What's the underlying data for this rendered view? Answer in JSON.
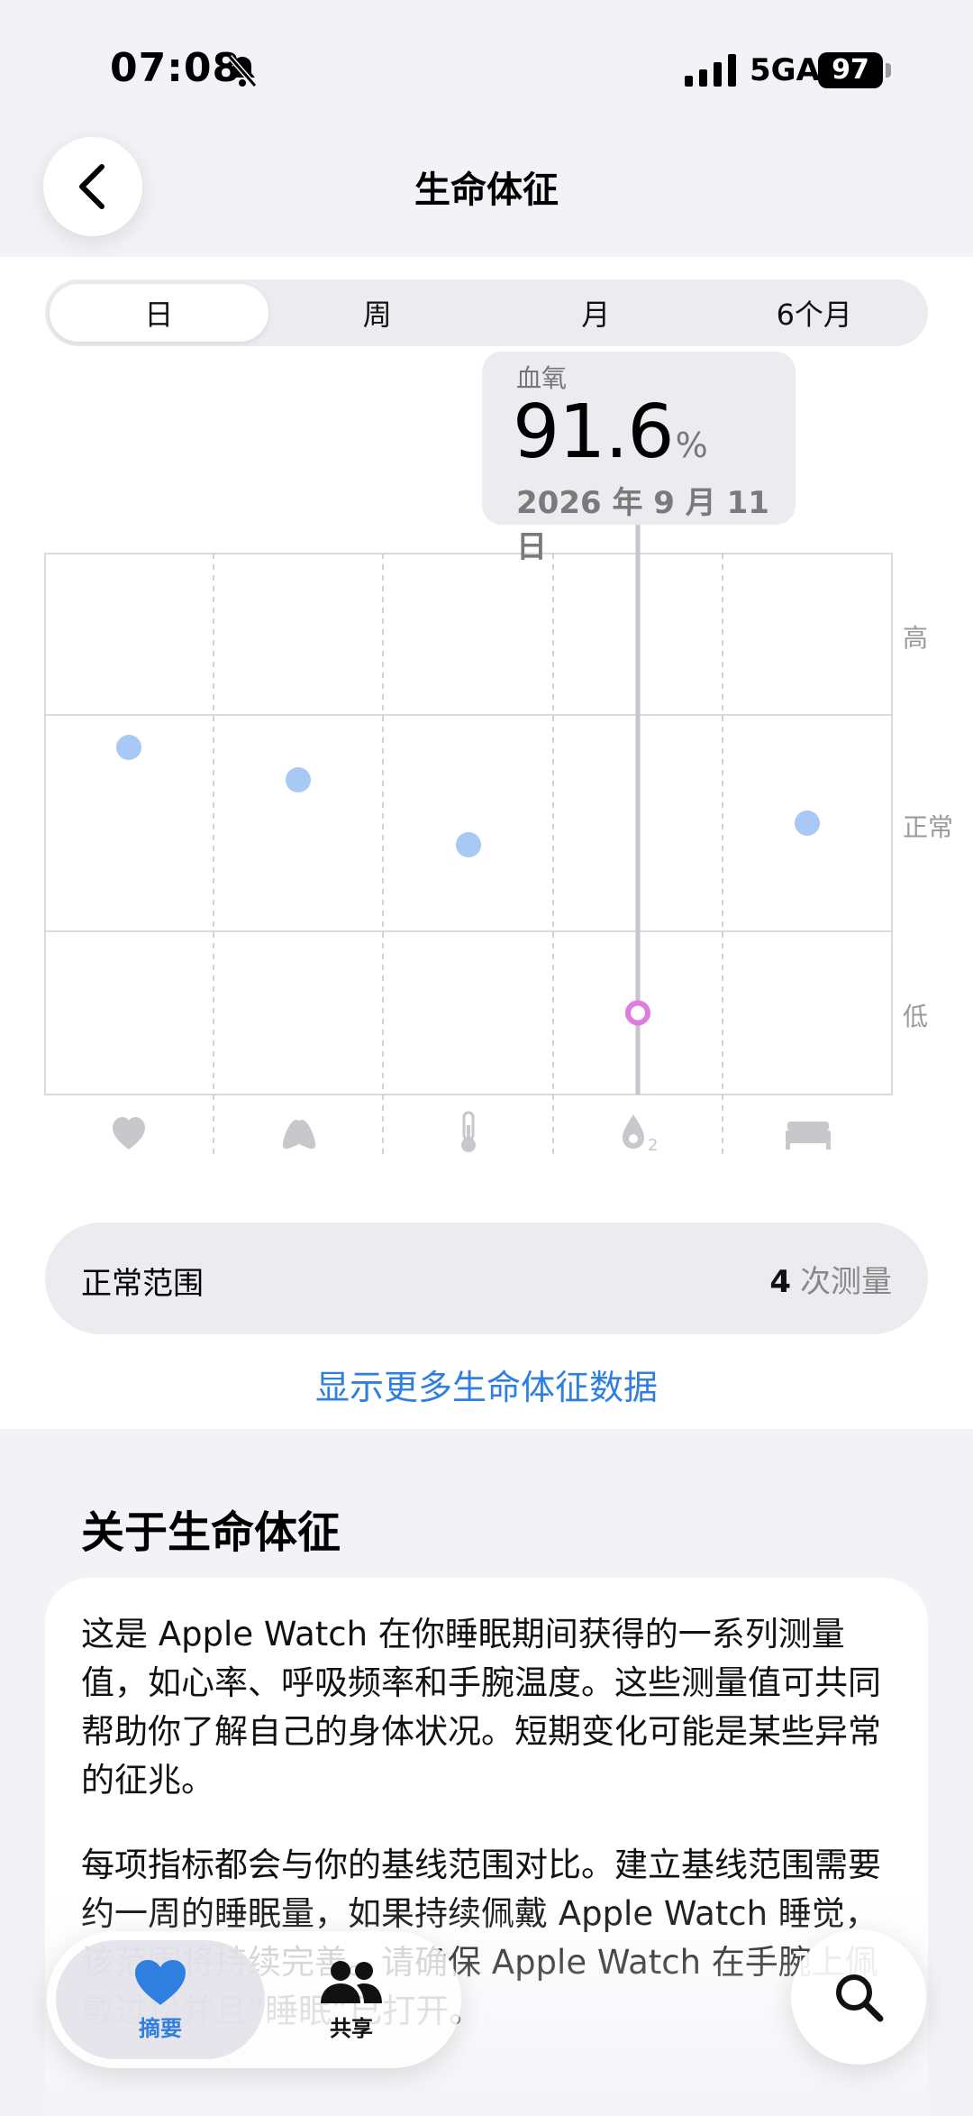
{
  "status_bar": {
    "time": "07:08",
    "network": "5GA",
    "battery": "97",
    "icons": [
      "bell-slash-icon",
      "signal-icon"
    ]
  },
  "nav": {
    "title": "生命体征",
    "back_icon": "chevron-left-icon"
  },
  "segments": {
    "items": [
      "日",
      "周",
      "月",
      "6个月"
    ],
    "selected": "日"
  },
  "tooltip": {
    "label": "血氧",
    "value": "91.6",
    "unit": "%",
    "date": "2026 年 9 月 11 日"
  },
  "chart_data": {
    "type": "scatter",
    "y_labels": [
      "高",
      "正常",
      "低"
    ],
    "categories": [
      "heart-icon",
      "lungs-icon",
      "thermometer-icon",
      "blood-oxygen-icon",
      "bed-icon"
    ],
    "levels": [
      {
        "category": "heart-icon",
        "level": "正常",
        "position": 0.15
      },
      {
        "category": "lungs-icon",
        "level": "正常",
        "position": 0.3
      },
      {
        "category": "thermometer-icon",
        "level": "正常",
        "position": 0.6
      },
      {
        "category": "blood-oxygen-icon",
        "level": "低",
        "position": 0.5,
        "selected": true
      },
      {
        "category": "bed-icon",
        "level": "正常",
        "position": 0.5
      }
    ],
    "colors": {
      "normal_point": "#a8c8f5",
      "selected_point": "#e07be0"
    }
  },
  "range_card": {
    "label": "正常范围",
    "count": "4",
    "count_suffix": "次测量"
  },
  "more_link": "显示更多生命体征数据",
  "about": {
    "title": "关于生命体征",
    "paragraph1": "这是 Apple Watch 在你睡眠期间获得的一系列测量值，如心率、呼吸频率和手腕温度。这些测量值可共同帮助你了解自己的身体状况。短期变化可能是某些异常的征兆。",
    "paragraph2": "每项指标都会与你的基线范围对比。建立基线范围需要约一周的睡眠量，如果持续佩戴 Apple Watch 睡觉，该范围将持续完善。请确保 Apple Watch 在手腕上佩戴过松并且“睡眠”已打开。"
  },
  "tabbar": {
    "summary_label": "摘要",
    "sharing_label": "共享"
  },
  "colors": {
    "accent": "#2f7fe0",
    "background": "#f2f2f7"
  }
}
